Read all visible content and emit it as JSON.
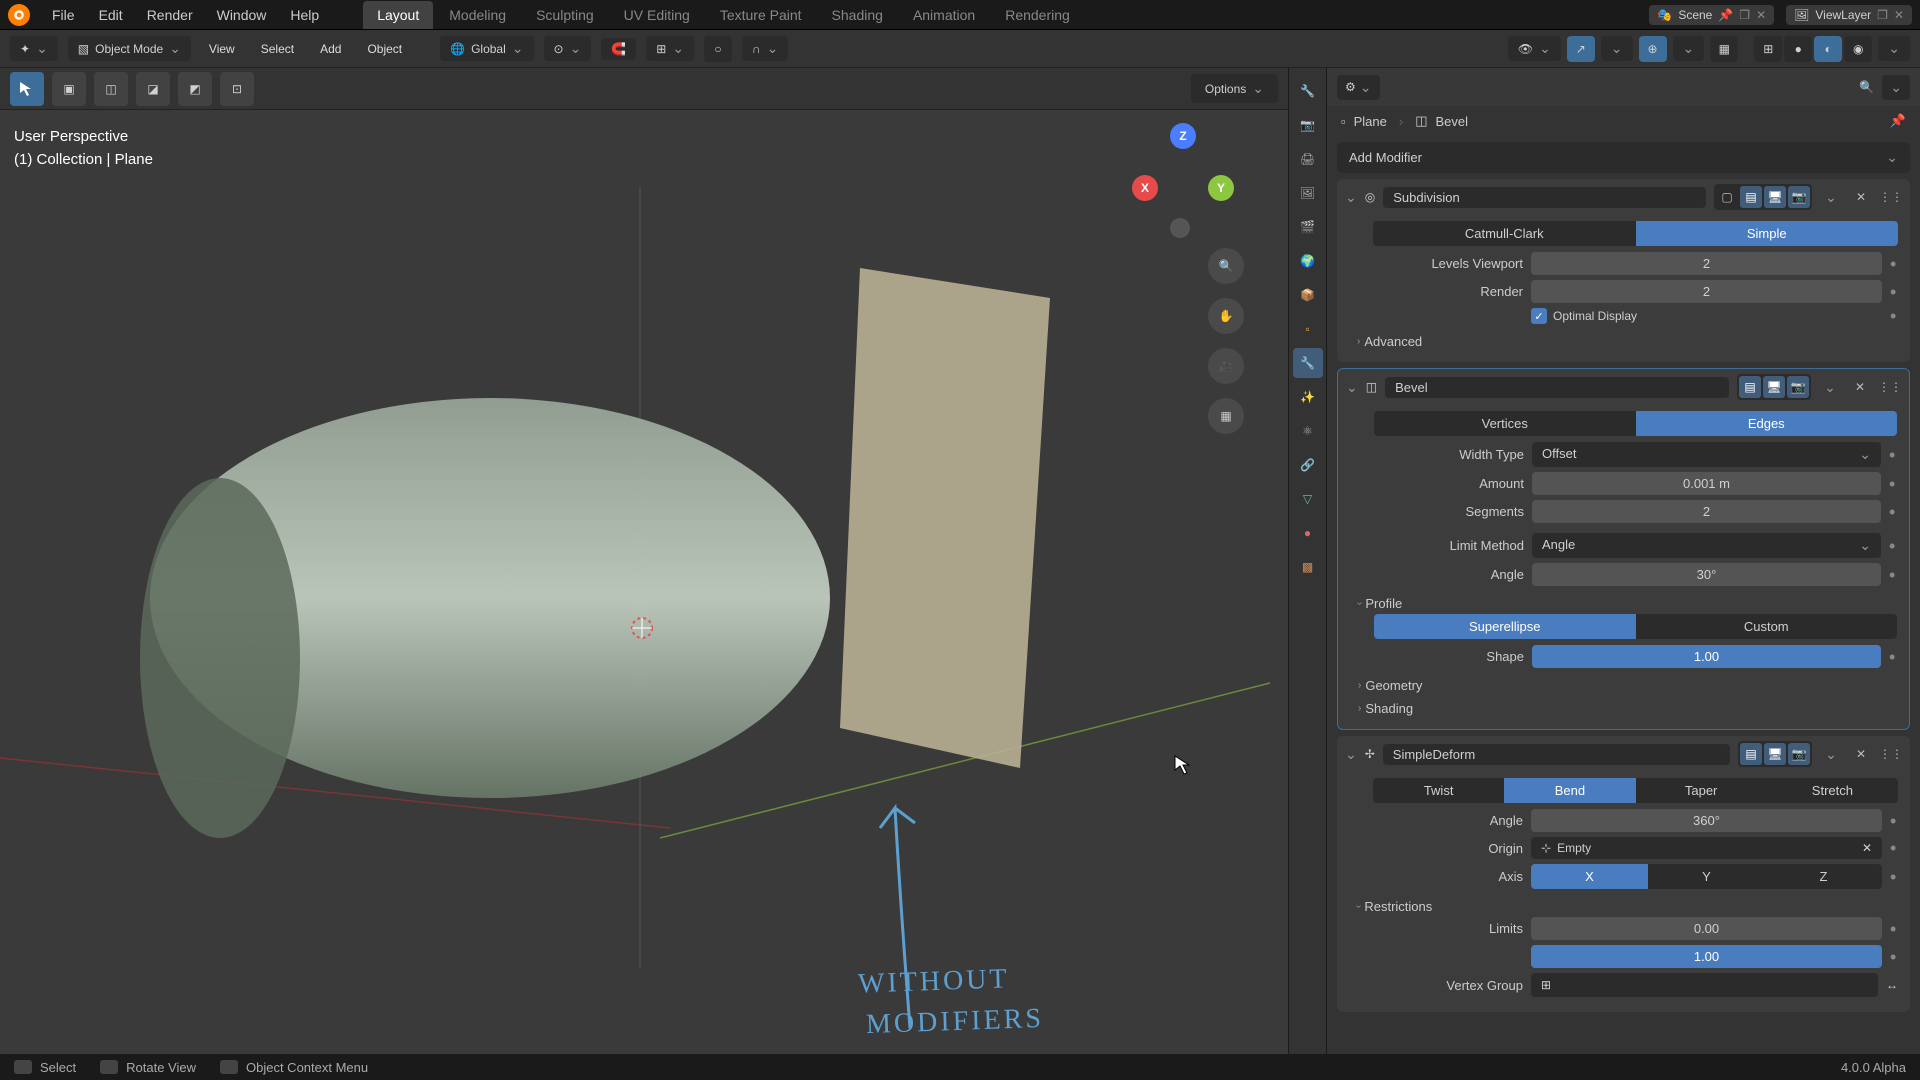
{
  "topmenu": {
    "file": "File",
    "edit": "Edit",
    "render": "Render",
    "window": "Window",
    "help": "Help"
  },
  "workspaces": [
    "Layout",
    "Modeling",
    "Sculpting",
    "UV Editing",
    "Texture Paint",
    "Shading",
    "Animation",
    "Rendering"
  ],
  "scene_label": "Scene",
  "viewlayer_label": "ViewLayer",
  "header": {
    "mode": "Object Mode",
    "view": "View",
    "select": "Select",
    "add": "Add",
    "object": "Object",
    "orientation": "Global"
  },
  "toolrow": {
    "options": "Options"
  },
  "viewport": {
    "line1": "User Perspective",
    "line2": "(1) Collection | Plane",
    "handwriting1": "WITHOUT",
    "handwriting2": "MODIFIERS"
  },
  "gizmo": {
    "x": "X",
    "y": "Y",
    "z": "Z"
  },
  "breadcrumb": {
    "obj": "Plane",
    "mod": "Bevel"
  },
  "add_modifier": "Add Modifier",
  "subdivision": {
    "title": "Subdivision",
    "catmull": "Catmull-Clark",
    "simple": "Simple",
    "levels_viewport_label": "Levels Viewport",
    "levels_viewport": "2",
    "render_label": "Render",
    "render": "2",
    "optimal": "Optimal Display",
    "advanced": "Advanced"
  },
  "bevel": {
    "title": "Bevel",
    "vertices": "Vertices",
    "edges": "Edges",
    "width_type_label": "Width Type",
    "width_type": "Offset",
    "amount_label": "Amount",
    "amount": "0.001 m",
    "segments_label": "Segments",
    "segments": "2",
    "limit_method_label": "Limit Method",
    "limit_method": "Angle",
    "angle_label": "Angle",
    "angle": "30°",
    "profile": "Profile",
    "superellipse": "Superellipse",
    "custom": "Custom",
    "shape_label": "Shape",
    "shape": "1.00",
    "geometry": "Geometry",
    "shading": "Shading"
  },
  "simpledeform": {
    "title": "SimpleDeform",
    "twist": "Twist",
    "bend": "Bend",
    "taper": "Taper",
    "stretch": "Stretch",
    "angle_label": "Angle",
    "angle": "360°",
    "origin_label": "Origin",
    "origin": "Empty",
    "axis_label": "Axis",
    "x": "X",
    "y": "Y",
    "z": "Z",
    "restrictions": "Restrictions",
    "limits_label": "Limits",
    "limit_lo": "0.00",
    "limit_hi": "1.00",
    "vg_label": "Vertex Group"
  },
  "status": {
    "select": "Select",
    "rotate": "Rotate View",
    "context": "Object Context Menu",
    "version": "4.0.0 Alpha"
  }
}
